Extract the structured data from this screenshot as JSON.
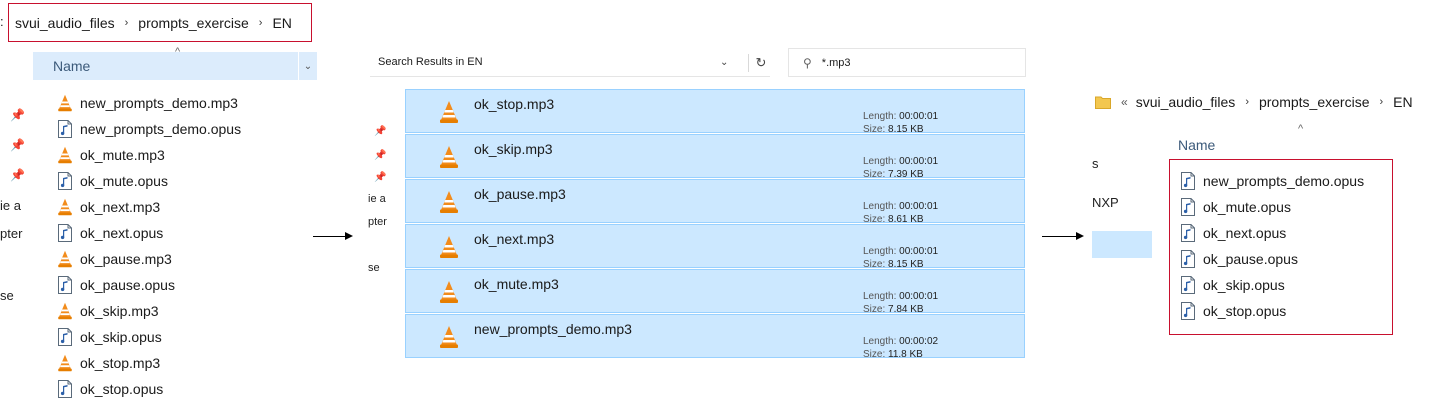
{
  "panel1": {
    "breadcrumb": [
      "svui_audio_files",
      "prompts_exercise",
      "EN"
    ],
    "left_cut_text": ":",
    "column_header": "Name",
    "nav_cut_labels": [
      "ie a",
      "pter",
      "se"
    ],
    "files": [
      {
        "name": "new_prompts_demo.mp3",
        "type": "mp3"
      },
      {
        "name": "new_prompts_demo.opus",
        "type": "opus"
      },
      {
        "name": "ok_mute.mp3",
        "type": "mp3"
      },
      {
        "name": "ok_mute.opus",
        "type": "opus"
      },
      {
        "name": "ok_next.mp3",
        "type": "mp3"
      },
      {
        "name": "ok_next.opus",
        "type": "opus"
      },
      {
        "name": "ok_pause.mp3",
        "type": "mp3"
      },
      {
        "name": "ok_pause.opus",
        "type": "opus"
      },
      {
        "name": "ok_skip.mp3",
        "type": "mp3"
      },
      {
        "name": "ok_skip.opus",
        "type": "opus"
      },
      {
        "name": "ok_stop.mp3",
        "type": "mp3"
      },
      {
        "name": "ok_stop.opus",
        "type": "opus"
      }
    ]
  },
  "panel2": {
    "address": "Search Results in EN",
    "search_value": "*.mp3",
    "nav_cut_labels": [
      "pte",
      "ie a",
      "pter",
      "se"
    ],
    "length_label": "Length:",
    "size_label": "Size:",
    "results": [
      {
        "name": "ok_stop.mp3",
        "length": "00:00:01",
        "size": "8.15 KB"
      },
      {
        "name": "ok_skip.mp3",
        "length": "00:00:01",
        "size": "7.39 KB"
      },
      {
        "name": "ok_pause.mp3",
        "length": "00:00:01",
        "size": "8.61 KB"
      },
      {
        "name": "ok_next.mp3",
        "length": "00:00:01",
        "size": "8.15 KB"
      },
      {
        "name": "ok_mute.mp3",
        "length": "00:00:01",
        "size": "7.84 KB"
      },
      {
        "name": "new_prompts_demo.mp3",
        "length": "00:00:02",
        "size": "11.8 KB"
      }
    ]
  },
  "panel3": {
    "breadcrumb_prefix": "«",
    "breadcrumb": [
      "svui_audio_files",
      "prompts_exercise",
      "EN"
    ],
    "column_header": "Name",
    "nav_cut_labels": [
      "s",
      "NXP"
    ],
    "files": [
      {
        "name": "new_prompts_demo.opus",
        "type": "opus"
      },
      {
        "name": "ok_mute.opus",
        "type": "opus"
      },
      {
        "name": "ok_next.opus",
        "type": "opus"
      },
      {
        "name": "ok_pause.opus",
        "type": "opus"
      },
      {
        "name": "ok_skip.opus",
        "type": "opus"
      },
      {
        "name": "ok_stop.opus",
        "type": "opus"
      }
    ]
  },
  "colors": {
    "highlight_box": "#c8102e",
    "selection": "#cce8ff",
    "header": "#dcecfc"
  }
}
